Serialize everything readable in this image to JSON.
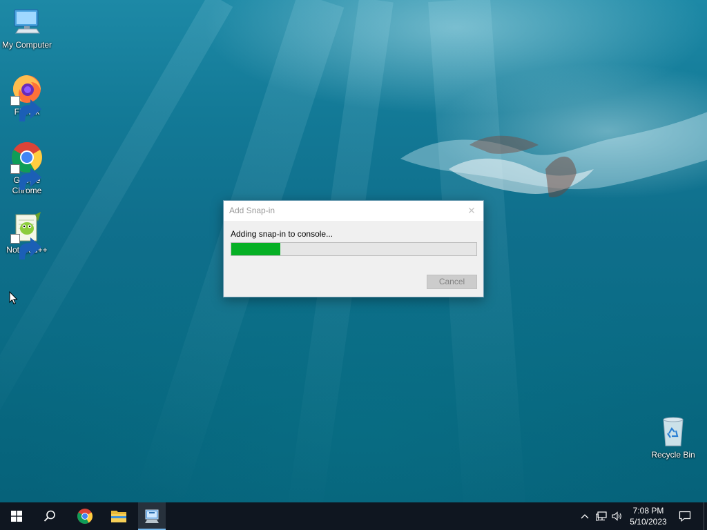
{
  "desktop": {
    "icons": [
      {
        "label": "My Computer"
      },
      {
        "label": "Firefox"
      },
      {
        "label": "Google Chrome"
      },
      {
        "label": "Notepad++"
      },
      {
        "label": "Recycle Bin"
      }
    ]
  },
  "dialog": {
    "title": "Add Snap-in",
    "close_glyph": "✕",
    "message": "Adding snap-in to console...",
    "progress_fraction": 0.2,
    "progress_color": "#06b025",
    "cancel_label": "Cancel"
  },
  "taskbar": {
    "buttons": [
      {
        "icon": "windows-start-icon"
      },
      {
        "icon": "search-icon"
      },
      {
        "icon": "chrome-icon"
      },
      {
        "icon": "file-explorer-icon"
      },
      {
        "icon": "mmc-console-icon",
        "active": true
      }
    ],
    "tray": {
      "icons": [
        "chevron-up-icon",
        "network-icon",
        "volume-icon",
        "notification-icon"
      ],
      "time": "7:08 PM",
      "date": "5/10/2023"
    },
    "accent_color": "#76b9ed"
  }
}
